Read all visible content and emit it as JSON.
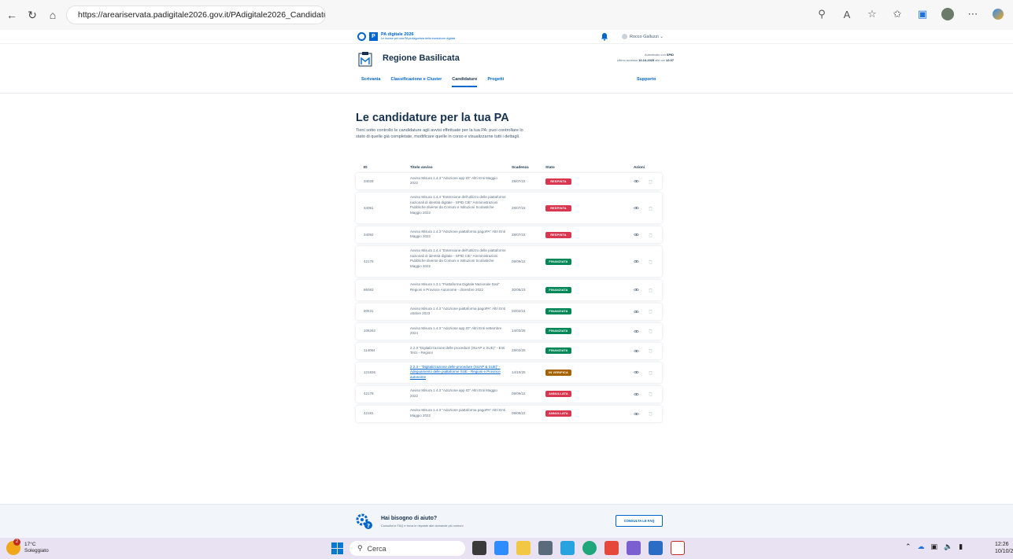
{
  "browser": {
    "url": "https://areariservata.padigitale2026.gov.it/PAdigitale2026_Candidature"
  },
  "topbar": {
    "brand_title": "PA digitale 2026",
    "brand_subtitle": "Le risorse per una PA protagonista della transizione digitale",
    "user_name": "Rocco Galluzzi ⌄"
  },
  "header": {
    "region_name": "Regione Basilicata",
    "auth_label": "Autenticato con",
    "auth_method": "SPID",
    "last_access_label": "Ultimo accesso",
    "last_access_date": "10-10-2025",
    "last_access_mid": "alle ore",
    "last_access_time": "12:07",
    "menu": [
      "Scrivania",
      "Classificazione e Cluster",
      "Candidature",
      "Progetti"
    ],
    "support": "Supporto"
  },
  "main": {
    "title": "Le candidature per la tua PA",
    "intro": "Tieni sotto controllo le candidature agli avvisi effettuate per la tua PA: puoi controllare lo stato di quelle già completate, modificare quelle in corso e visualizzarne tutti i dettagli.",
    "columns": [
      "ID",
      "Titolo avviso",
      "Scadenza",
      "Stato",
      "Azioni"
    ],
    "rows": [
      {
        "id": "34028",
        "title": "Avviso Misura 1.4.3 \"Adozione app IO\" Altri Enti Maggio 2022",
        "date": "28/07/22",
        "status": "RESPINTA",
        "color": "#d9364f",
        "link": false
      },
      {
        "id": "34081",
        "title": "Avviso Misura 1.4.4 \"Estensione dell'utilizzo delle piattaforme nazionali di identità digitale - SPID CIE\" Amministrazioni Pubbliche diverse da Comuni e Istituzioni Scolastiche Maggio 2022",
        "date": "28/07/22",
        "status": "RESPINTA",
        "color": "#d9364f",
        "link": false
      },
      {
        "id": "34092",
        "title": "Avviso Misura 1.4.3 \"Adozione piattaforma pagoPA\" Altri Enti Maggio 2022",
        "date": "28/07/22",
        "status": "RESPINTA",
        "color": "#d9364f",
        "link": false
      },
      {
        "id": "42176",
        "title": "Avviso Misura 1.4.4 \"Estensione dell'utilizzo delle piattaforme nazionali di identità digitale - SPID CIE\" Amministrazioni Pubbliche diverse da Comuni e Istituzioni Scolastiche Maggio 2022",
        "date": "09/09/22",
        "status": "FINANZIATA",
        "color": "#008758",
        "link": false
      },
      {
        "id": "86083",
        "title": "Avviso Misura 1.3.1 \"Piattaforma Digitale Nazionale Dati\" Regioni e Province Autonome - dicembre 2022",
        "date": "30/06/23",
        "status": "FINANZIATA",
        "color": "#008758",
        "link": false
      },
      {
        "id": "90531",
        "title": "Avviso Misura 1.4.3 \"Adozione piattaforma pagoPA\" Altri Enti ottobre 2023",
        "date": "02/02/24",
        "status": "FINANZIATA",
        "color": "#008758",
        "link": false
      },
      {
        "id": "106262",
        "title": "Avviso Misura 1.4.3 \"Adozione app IO\" Altri Enti settembre 2024",
        "date": "14/03/25",
        "status": "FINANZIATA",
        "color": "#008758",
        "link": false
      },
      {
        "id": "114064",
        "title": "2.2.3 \"Digitalizzazione delle procedure (SUAP e SUE)\" - Enti Terzi - Regioni",
        "date": "28/03/25",
        "status": "FINANZIATA",
        "color": "#008758",
        "link": false
      },
      {
        "id": "121826",
        "title": "2.2.3 - \"Digitalizzazione delle procedure (SUAP & SUE)\" - Adeguamento delle piattaforme SUE - Regioni e Province autonome",
        "date": "14/10/25",
        "status": "IN VERIFICA",
        "color": "#a66300",
        "link": true
      },
      {
        "id": "42178",
        "title": "Avviso Misura 1.4.3 \"Adozione app IO\" Altri Enti Maggio 2022",
        "date": "09/09/22",
        "status": "ANNULLATA",
        "color": "#d9364f",
        "link": false
      },
      {
        "id": "42181",
        "title": "Avviso Misura 1.4.3 \"Adozione piattaforma pagoPA\" Altri Enti Maggio 2022",
        "date": "09/09/22",
        "status": "ANNULLATA",
        "color": "#d9364f",
        "link": false
      }
    ]
  },
  "help": {
    "title": "Hai bisogno di aiuto?",
    "subtitle": "Consulta le FAQ e trova le risposte alle domande più comuni",
    "button": "CONSULTA LE FAQ"
  },
  "taskbar": {
    "temperature": "17°C",
    "weather": "Soleggiato",
    "notif_count": "2",
    "search_placeholder": "Cerca",
    "time": "12:26",
    "date": "10/10/2025"
  },
  "colors": {
    "primary": "#0066cc",
    "dark": "#17324d",
    "danger": "#d9364f",
    "success": "#008758",
    "warning": "#a66300"
  }
}
